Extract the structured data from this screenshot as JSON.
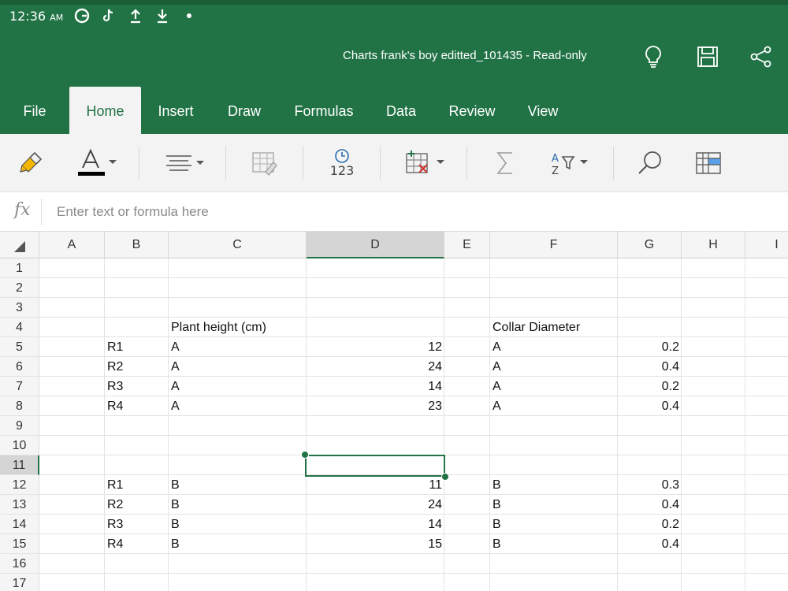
{
  "status_bar": {
    "time": "12:36",
    "ampm": "AM",
    "icons": [
      "g-app-icon",
      "tiktok-icon",
      "upload-icon",
      "download-icon",
      "dot-icon"
    ]
  },
  "header": {
    "title": "Charts frank's boy editted_101435 - Read-only",
    "icons": [
      "lightbulb-icon",
      "save-icon",
      "share-icon"
    ],
    "colors": {
      "brand": "#217346",
      "strip": "#1a5e38"
    }
  },
  "tabs": [
    {
      "label": "File",
      "active": false
    },
    {
      "label": "Home",
      "active": true
    },
    {
      "label": "Insert",
      "active": false
    },
    {
      "label": "Draw",
      "active": false
    },
    {
      "label": "Formulas",
      "active": false
    },
    {
      "label": "Data",
      "active": false
    },
    {
      "label": "Review",
      "active": false
    },
    {
      "label": "View",
      "active": false
    }
  ],
  "ribbon": {
    "number_format_label": "123",
    "icons": [
      "format-painter-icon",
      "font-color-icon",
      "align-icon",
      "cell-style-icon",
      "number-format-icon",
      "insert-delete-cells-icon",
      "autosum-icon",
      "sort-filter-icon",
      "find-icon",
      "table-icon"
    ]
  },
  "formula_bar": {
    "fx_label": "fx",
    "placeholder": "Enter text or formula here",
    "value": ""
  },
  "grid": {
    "columns": [
      "A",
      "B",
      "C",
      "D",
      "E",
      "F",
      "G",
      "H",
      "I"
    ],
    "selected_column": "D",
    "rows": [
      "1",
      "2",
      "3",
      "4",
      "5",
      "6",
      "7",
      "8",
      "9",
      "10",
      "11",
      "12",
      "13",
      "14",
      "15",
      "16",
      "17"
    ],
    "selected_row": "11",
    "selected_cell": "D11",
    "cells": {
      "C4": "Plant height (cm)",
      "F4": "Collar Diameter",
      "B5": "R1",
      "C5": "A",
      "D5": "12",
      "F5": "A",
      "G5": "0.2",
      "B6": "R2",
      "C6": "A",
      "D6": "24",
      "F6": "A",
      "G6": "0.4",
      "B7": "R3",
      "C7": "A",
      "D7": "14",
      "F7": "A",
      "G7": "0.2",
      "B8": "R4",
      "C8": "A",
      "D8": "23",
      "F8": "A",
      "G8": "0.4",
      "B12": "R1",
      "C12": "B",
      "D12": "11",
      "F12": "B",
      "G12": "0.3",
      "B13": "R2",
      "C13": "B",
      "D13": "24",
      "F13": "B",
      "G13": "0.4",
      "B14": "R3",
      "C14": "B",
      "D14": "14",
      "F14": "B",
      "G14": "0.2",
      "B15": "R4",
      "C15": "B",
      "D15": "15",
      "F15": "B",
      "G15": "0.4"
    },
    "numeric_cells": [
      "D5",
      "D6",
      "D7",
      "D8",
      "D12",
      "D13",
      "D14",
      "D15",
      "G5",
      "G6",
      "G7",
      "G8",
      "G12",
      "G13",
      "G14",
      "G15"
    ]
  }
}
